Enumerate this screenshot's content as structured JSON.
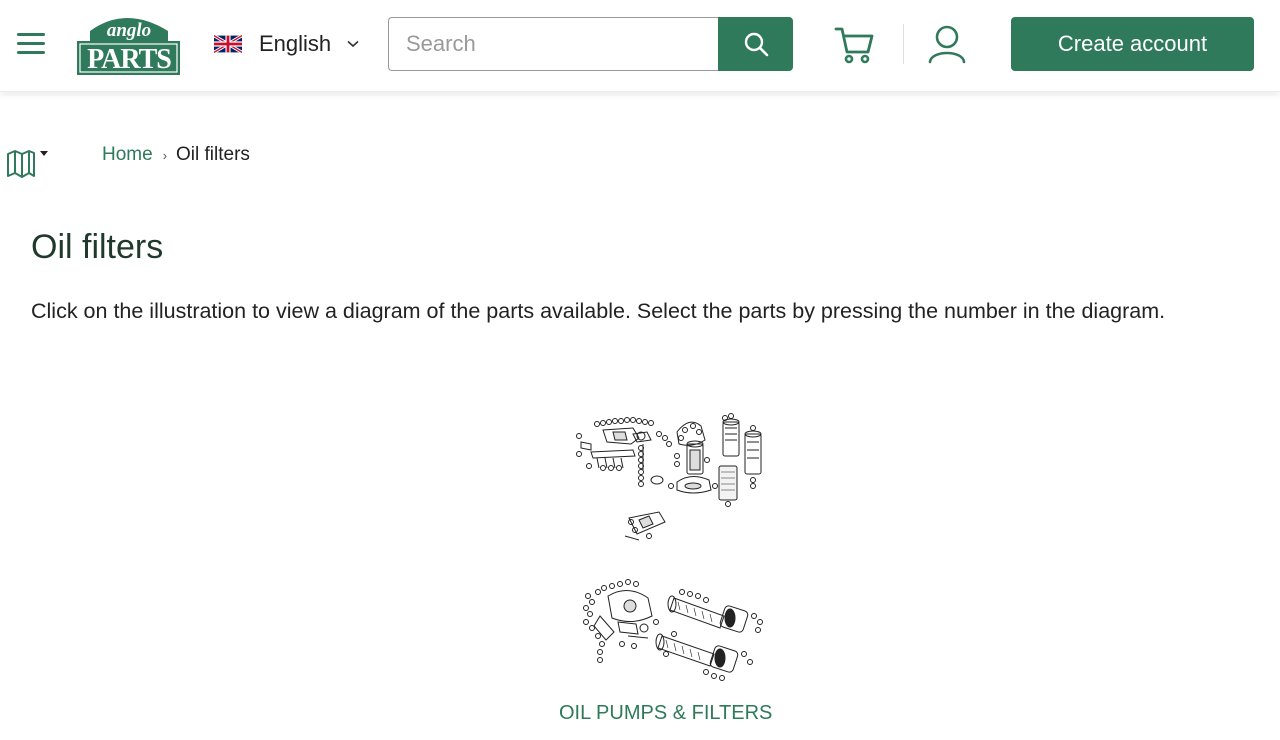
{
  "header": {
    "logo": {
      "top_word": "anglo",
      "bottom_word": "PARTS",
      "color": "#2e7a5a"
    },
    "language": {
      "label": "English",
      "flag": "uk-flag-icon"
    },
    "search": {
      "placeholder": "Search",
      "value": ""
    },
    "create_account_label": "Create account",
    "accent_color": "#2e7a5a"
  },
  "breadcrumb": {
    "home": "Home",
    "current": "Oil filters"
  },
  "main": {
    "title": "Oil filters",
    "intro": "Click on the illustration to view a diagram of the parts available. Select the parts by pressing the number in the diagram.",
    "categories": [
      {
        "label": "OIL PUMPS & FILTERS"
      }
    ]
  },
  "icons": [
    "menu-icon",
    "uk-flag-icon",
    "chevron-down-icon",
    "search-icon",
    "cart-icon",
    "user-icon",
    "book-icon",
    "caret-down-icon"
  ]
}
